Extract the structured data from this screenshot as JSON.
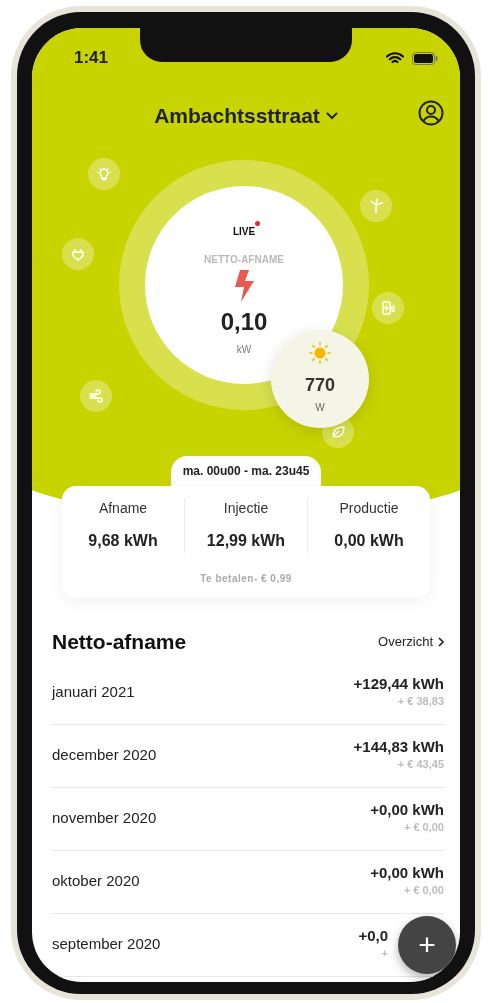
{
  "status_bar": {
    "time": "1:41"
  },
  "header": {
    "location": "Ambachtssttraat"
  },
  "live_meter": {
    "live_label": "LIVE",
    "live": true,
    "title": "NETTO-AFNAME",
    "value": "0,10",
    "unit": "kW"
  },
  "solar": {
    "value": "770",
    "unit": "W"
  },
  "period": "ma. 00u00 - ma. 23u45",
  "summary": {
    "stats": [
      {
        "label": "Afname",
        "value": "9,68 kWh"
      },
      {
        "label": "Injectie",
        "value": "12,99 kWh"
      },
      {
        "label": "Productie",
        "value": "0,00 kWh"
      }
    ],
    "payment": "Te betalen- € 0,99"
  },
  "history": {
    "title": "Netto-afname",
    "link": "Overzicht",
    "rows": [
      {
        "month": "januari 2021",
        "energy": "+129,44 kWh",
        "cost": "+ € 38,83",
        "covered": false
      },
      {
        "month": "december 2020",
        "energy": "+144,83 kWh",
        "cost": "+ € 43,45",
        "covered": false
      },
      {
        "month": "november 2020",
        "energy": "+0,00 kWh",
        "cost": "+ € 0,00",
        "covered": false
      },
      {
        "month": "oktober 2020",
        "energy": "+0,00 kWh",
        "cost": "+ € 0,00",
        "covered": false
      },
      {
        "month": "september 2020",
        "energy": "+0,0",
        "cost": "+",
        "covered": true
      }
    ]
  },
  "fab": {
    "label": "+"
  }
}
